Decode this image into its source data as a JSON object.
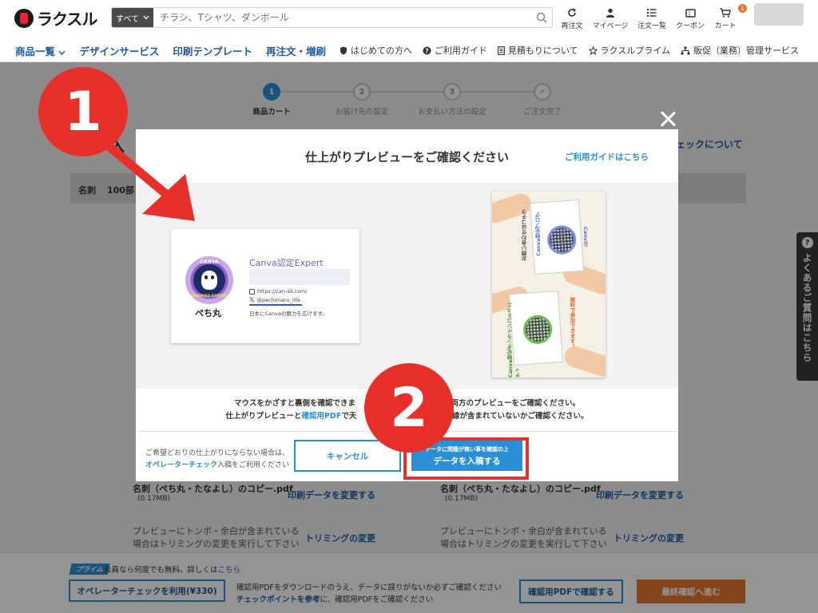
{
  "header": {
    "logo_text": "ラクスル",
    "search_category": "すべて",
    "search_placeholder": "チラシ、Tシャツ、ダンボール",
    "nav": [
      {
        "label": "再注文",
        "icon": "reorder-icon"
      },
      {
        "label": "マイページ",
        "icon": "user-icon"
      },
      {
        "label": "注文一覧",
        "icon": "list-icon"
      },
      {
        "label": "クーポン",
        "icon": "coupon-icon"
      },
      {
        "label": "カート",
        "icon": "cart-icon",
        "badge": "1"
      }
    ]
  },
  "menubar": {
    "main": [
      "商品一覧",
      "デザインサービス",
      "印刷テンプレート",
      "再注文・増刷"
    ],
    "sub": [
      {
        "label": "はじめての方へ",
        "icon": "shield-icon"
      },
      {
        "label": "ご利用ガイド",
        "icon": "question-icon"
      },
      {
        "label": "見積もりについて",
        "icon": "document-icon"
      },
      {
        "label": "ラクスルプライム",
        "icon": "star-icon"
      },
      {
        "label": "販促（業務）管理サービス",
        "icon": "org-icon"
      }
    ]
  },
  "steps": [
    {
      "num": "1",
      "label": "商品カート",
      "active": true
    },
    {
      "num": "2",
      "label": "お届け先の設定",
      "active": false
    },
    {
      "num": "3",
      "label": "お支払い方法の設定",
      "active": false
    },
    {
      "num": "✓",
      "label": "ご注文完了",
      "active": false
    }
  ],
  "background": {
    "title_fragment": "入",
    "right_link": "ェックについて",
    "row_label": "名刺",
    "row_qty": "100部",
    "file_left": "名刺（ぺち丸・たなよし）のコピー.pdf",
    "file_right": "名刺（ぺち丸・たなよし）のコピー.pdf",
    "file_size": "(0.17MB)",
    "change_data": "印刷データを変更する",
    "trim_note_1": "プレビューにトンボ・余白が含まれている",
    "trim_note_2": "場合はトリミングの変更を実行して下さい",
    "trim_link": "トリミングの変更"
  },
  "side_faq": "よくあるご質問はこちら",
  "bottom": {
    "prime_badge": "プライム",
    "prime_text": "会員なら何度でも無料。詳しくは",
    "prime_link": "こちら",
    "operator_button": "オペレーターチェックを利用(¥330)",
    "note_line1": "確認用PDFをダウンロードのうえ、データに誤りがないか必ずご確認ください",
    "note_link": "チェックポイントを参考",
    "note_line2": "に、確認用PDFをご確認ください",
    "pdf_button": "確認用PDFで確認する",
    "final_button": "最終確認へ進む"
  },
  "modal": {
    "title": "仕上がりプレビューをご確認ください",
    "guide_link": "ご利用ガイドはこちら",
    "front_card": {
      "badge_top": "CANVA",
      "badge_bottom": "VERIFIED EXPERT",
      "name": "ぺち丸",
      "title": "Canva認定Expert",
      "url": "https://can-sil.com/",
      "handle": "@pechimaru_life",
      "tagline": "日本にCanvaの魅力を広げます。"
    },
    "back_card": {
      "text_1": "お問い合わせはコチラ",
      "text_2": "Canva特化ブログ",
      "text_3": "Canva特化オンラインコミュニティ",
      "text_4": "無料で参加できます！",
      "logo": "Canvil!"
    },
    "msg_line1_a": "マウスをかざすと裏側を確認できま",
    "msg_line1_b": "か両方のプレビューをご確認ください。",
    "msg_line2_a": "仕上がりプレビューと",
    "msg_line2_link": "確認用PDF",
    "msg_line2_b": "で天",
    "msg_line2_c": "ド線が含まれていないかご確認ください。",
    "note_line1": "ご希望どおりの仕上がりにならない場合は、",
    "note_link": "オペレーターチェック",
    "note_line2": "入稿をご利用ください",
    "cancel": "キャンセル",
    "enter_small": "データに問題が無い事を確認の上",
    "enter_big": "データを入稿する"
  },
  "callouts": [
    "1",
    "2"
  ],
  "colors": {
    "accent": "#2b8fd6",
    "callout_red": "#e8302b",
    "final_orange": "#e6782d",
    "nav_blue": "#1c5aa0"
  }
}
